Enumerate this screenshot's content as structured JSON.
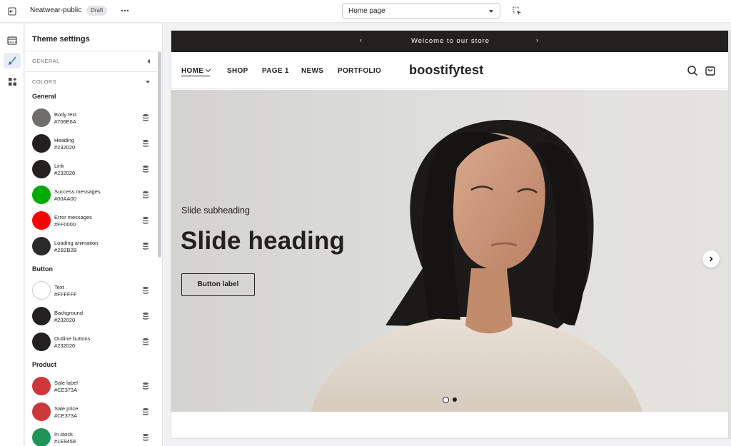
{
  "topbar": {
    "store_name": "Neatwear-public",
    "status_badge": "Draft",
    "page_select_value": "Home page",
    "icons": [
      "exit-icon",
      "more-horizontal-icon",
      "chevron-down-icon",
      "inspector-select-icon"
    ]
  },
  "rail": {
    "items": [
      {
        "name": "sections",
        "icon": "layout-sections-icon"
      },
      {
        "name": "theme-settings",
        "icon": "paintbrush-icon",
        "active": true
      },
      {
        "name": "apps",
        "icon": "apps-add-icon"
      }
    ]
  },
  "panel": {
    "title": "Theme settings",
    "sections": [
      {
        "label": "GENERAL",
        "expanded": false
      },
      {
        "label": "COLORS",
        "expanded": true
      }
    ],
    "groups": [
      {
        "title": "General"
      },
      {
        "title": "Button"
      },
      {
        "title": "Product"
      }
    ],
    "colors": [
      {
        "name": "Body text",
        "hex": "#706E6A"
      },
      {
        "name": "Heading",
        "hex": "#232020"
      },
      {
        "name": "Link",
        "hex": "#232020"
      },
      {
        "name": "Success messages",
        "hex": "#00AA00"
      },
      {
        "name": "Error messages",
        "hex": "#FF0000"
      },
      {
        "name": "Loading animation",
        "hex": "#2B2B2B"
      },
      {
        "name": "Text",
        "hex": "#FFFFFF"
      },
      {
        "name": "Background",
        "hex": "#232020"
      },
      {
        "name": "Outline buttons",
        "hex": "#232020"
      },
      {
        "name": "Sale label",
        "hex": "#CE373A"
      },
      {
        "name": "Sale price",
        "hex": "#CE373A"
      },
      {
        "name": "In stock",
        "hex": "#1E9458"
      }
    ]
  },
  "preview": {
    "announcement": "Welcome to our store",
    "nav": [
      "HOME",
      "SHOP",
      "PAGE 1",
      "NEWS",
      "PORTFOLIO"
    ],
    "logo": "boostifytest",
    "hero": {
      "subheading": "Slide subheading",
      "heading": "Slide heading",
      "button": "Button label",
      "slides": 2,
      "active_slide": 1
    }
  }
}
